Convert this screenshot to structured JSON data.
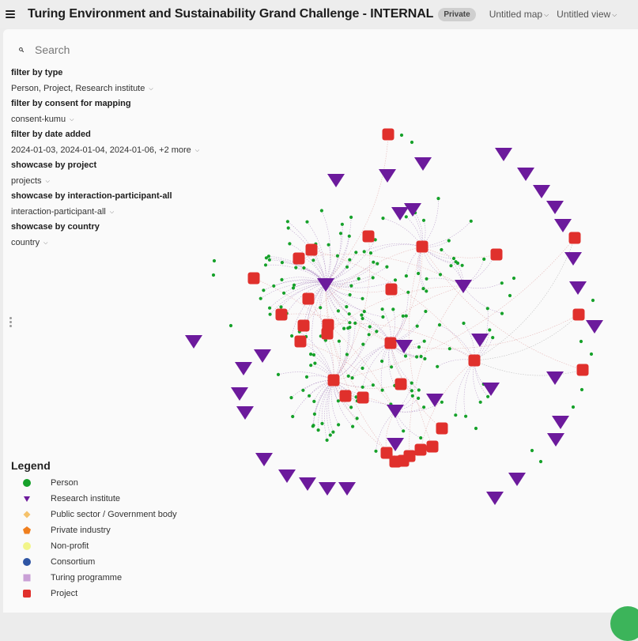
{
  "header": {
    "title": "Turing Environment and Sustainability Grand Challenge - INTERNAL",
    "badge": "Private",
    "map_dropdown": "Untitled map",
    "view_dropdown": "Untitled view"
  },
  "search": {
    "placeholder": "Search"
  },
  "filters": [
    {
      "label": "filter by type",
      "value": "Person, Project, Research institute"
    },
    {
      "label": "filter by consent for mapping",
      "value": "consent-kumu"
    },
    {
      "label": "filter by date added",
      "value": "2024-01-03, 2024-01-04, 2024-01-06, +2 more"
    },
    {
      "label": "showcase by project",
      "value": "projects"
    },
    {
      "label": "showcase by interaction-participant-all",
      "value": "interaction-participant-all"
    },
    {
      "label": "showcase by country",
      "value": "country"
    }
  ],
  "legend": {
    "title": "Legend",
    "items": [
      {
        "label": "Person",
        "shape": "circle",
        "color": "#16a12a"
      },
      {
        "label": "Research institute",
        "shape": "triangle",
        "color": "#6c1a9c"
      },
      {
        "label": "Public sector / Government body",
        "shape": "diamond",
        "color": "#f5c26b"
      },
      {
        "label": "Private industry",
        "shape": "pentagon",
        "color": "#f07f1e"
      },
      {
        "label": "Non-profit",
        "shape": "circle",
        "color": "#f2f58a"
      },
      {
        "label": "Consortium",
        "shape": "circle",
        "color": "#2f55a4"
      },
      {
        "label": "Turing programme",
        "shape": "square",
        "color": "#c9a0d6"
      },
      {
        "label": "Project",
        "shape": "roundsquare",
        "color": "#e0302c"
      }
    ]
  },
  "colors": {
    "person": "#16a12a",
    "research_institute": "#6c1a9c",
    "project": "#e0302c",
    "accent_fab": "#3cb45a"
  }
}
